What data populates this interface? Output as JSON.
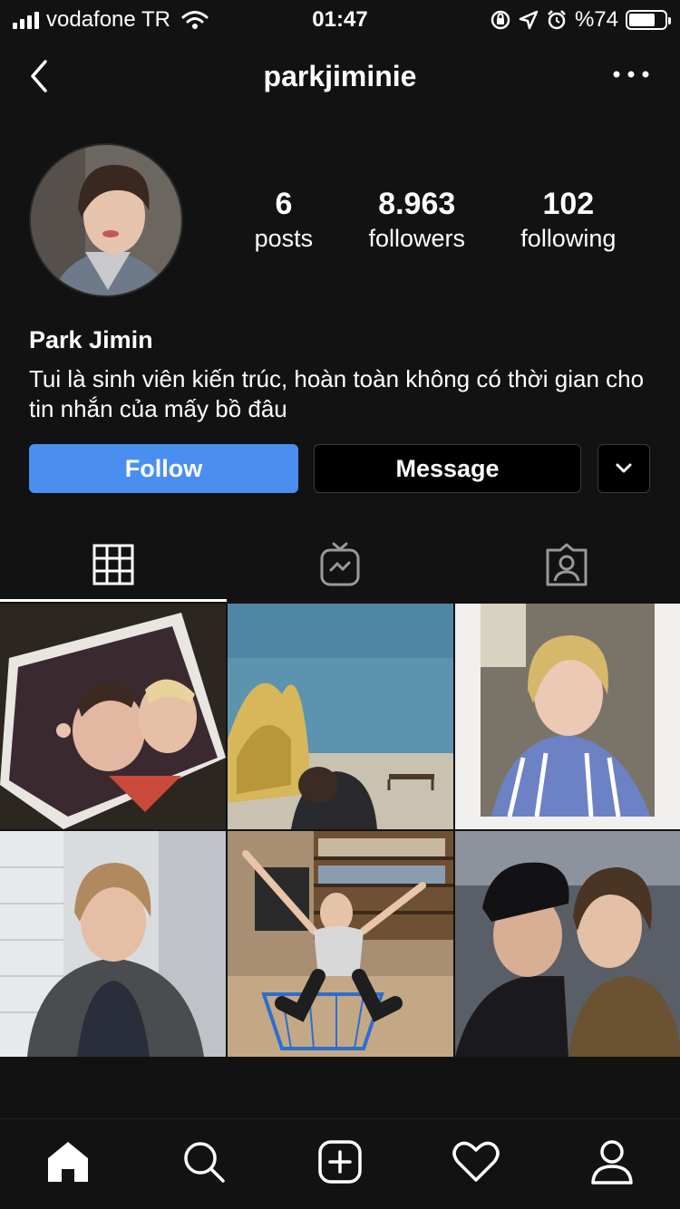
{
  "status_bar": {
    "carrier": "vodafone TR",
    "time": "01:47",
    "battery_text": "%74",
    "battery_level": 0.74
  },
  "nav": {
    "username": "parkjiminie"
  },
  "profile": {
    "stats": {
      "posts_value": "6",
      "posts_label": "posts",
      "followers_value": "8.963",
      "followers_label": "followers",
      "following_value": "102",
      "following_label": "following"
    },
    "full_name": "Park Jimin",
    "bio": "Tui là sinh viên kiến trúc, hoàn toàn không có thời gian cho tin nhắn của mấy bồ đâu"
  },
  "actions": {
    "follow_label": "Follow",
    "message_label": "Message"
  },
  "tabs": [
    {
      "icon": "grid-icon",
      "active": true
    },
    {
      "icon": "igtv-icon",
      "active": false
    },
    {
      "icon": "tagged-icon",
      "active": false
    }
  ],
  "bottom_bar": [
    "home-icon",
    "search-icon",
    "new-post-icon",
    "activity-heart-icon",
    "profile-icon"
  ],
  "colors": {
    "background": "#121212",
    "follow_button": "#4a8ff0",
    "text": "#ffffff"
  }
}
